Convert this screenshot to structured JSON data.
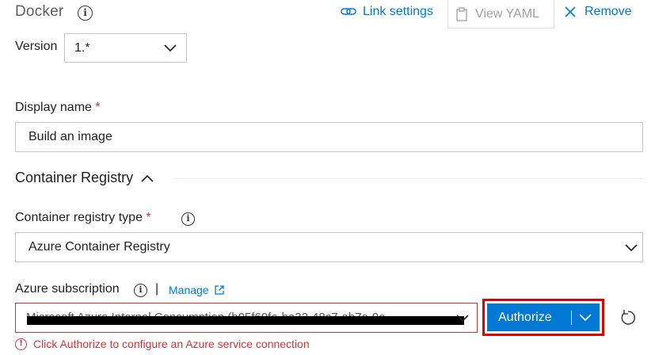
{
  "header": {
    "title": "Docker",
    "link_settings": "Link settings",
    "view_yaml": "View YAML",
    "remove": "Remove"
  },
  "version": {
    "label": "Version",
    "value": "1.*"
  },
  "display_name": {
    "label": "Display name",
    "required_mark": "*",
    "value": "Build an image"
  },
  "section": {
    "title": "Container Registry"
  },
  "registry_type": {
    "label": "Container registry type",
    "required_mark": "*",
    "value": "Azure Container Registry"
  },
  "subscription": {
    "label": "Azure subscription",
    "separator": "|",
    "manage_label": "Manage",
    "value": "Microsoft Azure Internal Consumption (b05f69fe-ba32-48c7-ab7e-9e",
    "authorize_label": "Authorize",
    "error_text": "Click Authorize to configure an Azure service connection"
  },
  "icons": {
    "info": "info-icon",
    "link": "link-icon",
    "clipboard": "clipboard-icon",
    "close": "close-icon",
    "chevron_down": "chevron-down-icon",
    "chevron_up": "chevron-up-icon",
    "external_link": "external-link-icon",
    "refresh": "refresh-icon",
    "error": "error-icon"
  },
  "colors": {
    "accent": "#0078d4",
    "error": "#d13438",
    "highlight_frame": "#e00000"
  }
}
